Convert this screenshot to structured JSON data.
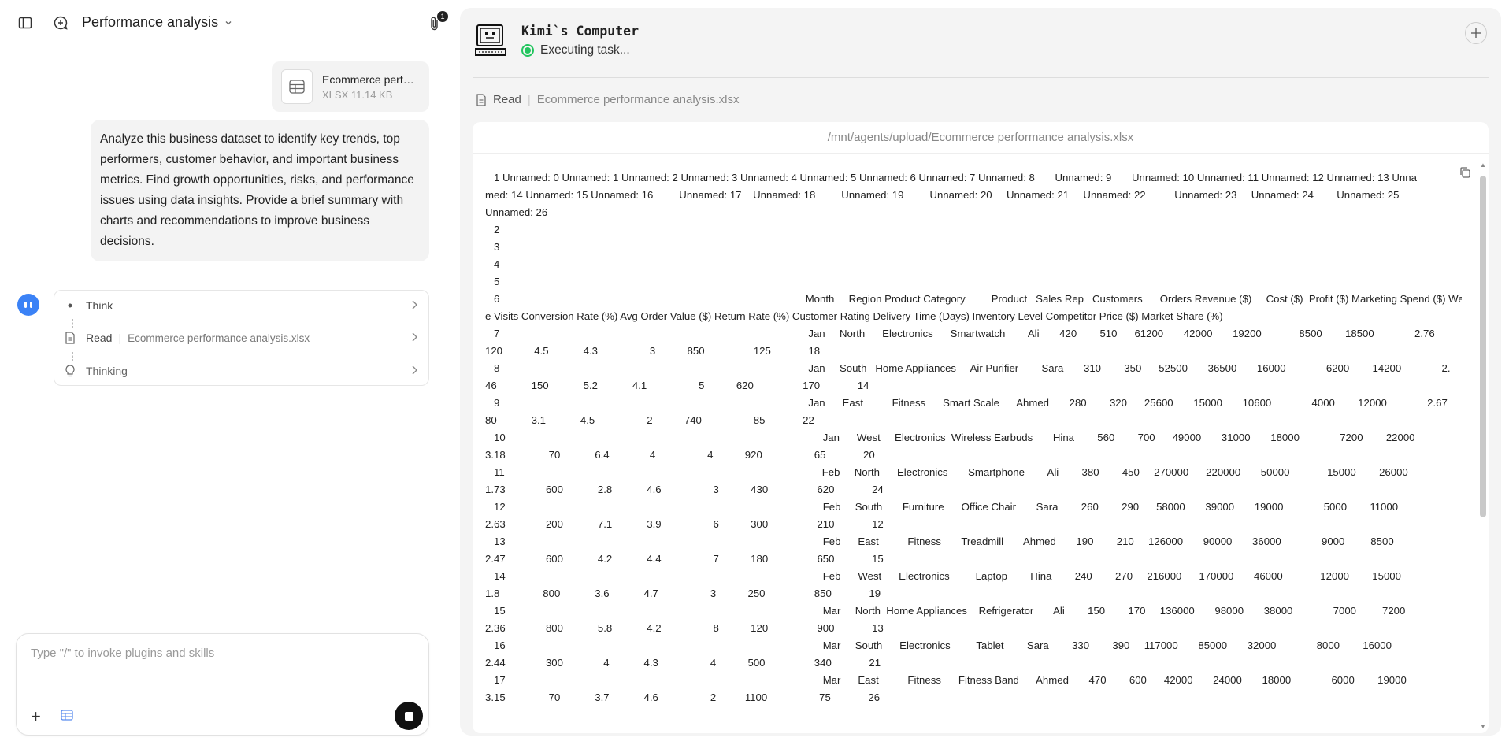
{
  "header": {
    "title": "Performance analysis",
    "attachments_count": "1"
  },
  "attachment": {
    "name": "Ecommerce perfor...",
    "meta": "XLSX 11.14 KB"
  },
  "user_message": "Analyze this business dataset to identify key trends, top performers, customer behavior, and important business metrics. Find growth opportunities, risks, and performance issues using data insights. Provide a brief summary with charts and recommendations to improve business decisions.",
  "steps": [
    {
      "label": "Think",
      "sub": ""
    },
    {
      "label": "Read",
      "sub": "Ecommerce performance analysis.xlsx"
    },
    {
      "label": "Thinking",
      "sub": ""
    }
  ],
  "composer": {
    "placeholder": "Type \"/\" to invoke plugins and skills"
  },
  "computer": {
    "title": "Kimi`s Computer",
    "status": "Executing task...",
    "action_label": "Read",
    "action_file": "Ecommerce performance analysis.xlsx",
    "path": "/mnt/agents/upload/Ecommerce performance analysis.xlsx",
    "content": "   1 Unnamed: 0 Unnamed: 1 Unnamed: 2 Unnamed: 3 Unnamed: 4 Unnamed: 5 Unnamed: 6 Unnamed: 7 Unnamed: 8       Unnamed: 9       Unnamed: 10 Unnamed: 11 Unnamed: 12 Unnamed: 13 Unna\nmed: 14 Unnamed: 15 Unnamed: 16         Unnamed: 17    Unnamed: 18         Unnamed: 19         Unnamed: 20     Unnamed: 21     Unnamed: 22          Unnamed: 23     Unnamed: 24        Unnamed: 25\nUnnamed: 26\n   2\n   3\n   4\n   5\n   6                                                                                                          Month     Region Product Category         Product   Sales Rep   Customers      Orders Revenue ($)     Cost ($)  Profit ($) Marketing Spend ($) Websit\ne Visits Conversion Rate (%) Avg Order Value ($) Return Rate (%) Customer Rating Delivery Time (Days) Inventory Level Competitor Price ($) Market Share (%)\n   7                                                                                                           Jan     North      Electronics      Smartwatch        Ali       420        510      61200       42000       19200             8500        18500              2.76\n120           4.5            4.3                  3           850                 125             18\n   8                                                                                                           Jan     South   Home Appliances     Air Purifier        Sara       310        350      52500       36500       16000              6200        14200              2.\n46            150            5.2            4.1                  5           620                 170             14\n   9                                                                                                           Jan      East          Fitness      Smart Scale      Ahmed       280        320      25600       15000       10600              4000        12000              2.67\n80            3.1            4.5                  2           740                  85             22\n   10                                                                                                              Jan      West     Electronics  Wireless Earbuds       Hina        560        700      49000       31000       18000              7200        22000\n3.18               70            6.4              4                  4           920                  65             20\n   11                                                                                                              Feb     North      Electronics       Smartphone        Ali        380        450     270000      220000       50000             15000        26000\n1.73              600            2.8            4.6                  3           430                 620             24\n   12                                                                                                              Feb     South       Furniture      Office Chair       Sara        260        290      58000       39000       19000              5000        11000\n2.63              200            7.1            3.9                  6           300                 210             12\n   13                                                                                                              Feb      East          Fitness       Treadmill       Ahmed       190        210     126000       90000       36000              9000         8500\n2.47              600            4.2            4.4                  7           180                 650             15\n   14                                                                                                              Feb      West      Electronics         Laptop        Hina        240        270     216000      170000       46000             12000        15000\n1.8               800            3.6            4.7                  3           250                 850             19\n   15                                                                                                              Mar     North  Home Appliances    Refrigerator       Ali        150        170     136000       98000       38000              7000         7200\n2.36              800            5.8            4.2                  8           120                 900             13\n   16                                                                                                              Mar     South      Electronics         Tablet        Sara        330        390     117000       85000       32000              8000        16000\n2.44              300              4            4.3                  4           500                 340             21\n   17                                                                                                              Mar      East          Fitness      Fitness Band      Ahmed       470        600      42000       24000       18000              6000        19000\n3.15               70            3.7            4.6                  2          1100                  75             26"
  }
}
